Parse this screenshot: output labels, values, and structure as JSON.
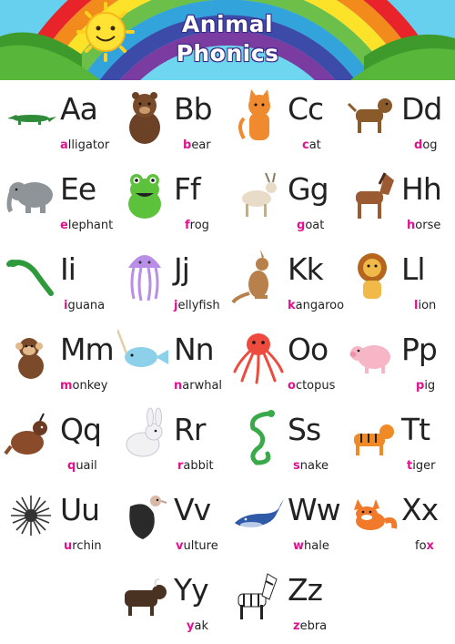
{
  "title": {
    "line1": "Animal",
    "line2": "Phonics"
  },
  "colors": {
    "highlight": "#e2128f",
    "text": "#222222",
    "title_text": "#ffffff"
  },
  "animals": [
    {
      "letters": "Aa",
      "first": "a",
      "rest": "lligator",
      "last": "",
      "icon": "alligator-icon"
    },
    {
      "letters": "Bb",
      "first": "b",
      "rest": "ear",
      "last": "",
      "icon": "bear-icon"
    },
    {
      "letters": "Cc",
      "first": "c",
      "rest": "at",
      "last": "",
      "icon": "cat-icon"
    },
    {
      "letters": "Dd",
      "first": "d",
      "rest": "og",
      "last": "",
      "icon": "dog-icon"
    },
    {
      "letters": "Ee",
      "first": "e",
      "rest": "lephant",
      "last": "",
      "icon": "elephant-icon"
    },
    {
      "letters": "Ff",
      "first": "f",
      "rest": "rog",
      "last": "",
      "icon": "frog-icon"
    },
    {
      "letters": "Gg",
      "first": "g",
      "rest": "oat",
      "last": "",
      "icon": "goat-icon"
    },
    {
      "letters": "Hh",
      "first": "h",
      "rest": "orse",
      "last": "",
      "icon": "horse-icon"
    },
    {
      "letters": "Ii",
      "first": "i",
      "rest": "guana",
      "last": "",
      "icon": "iguana-icon"
    },
    {
      "letters": "Jj",
      "first": "j",
      "rest": "ellyfish",
      "last": "",
      "icon": "jellyfish-icon"
    },
    {
      "letters": "Kk",
      "first": "k",
      "rest": "angaroo",
      "last": "",
      "icon": "kangaroo-icon"
    },
    {
      "letters": "Ll",
      "first": "l",
      "rest": "ion",
      "last": "",
      "icon": "lion-icon"
    },
    {
      "letters": "Mm",
      "first": "m",
      "rest": "onkey",
      "last": "",
      "icon": "monkey-icon"
    },
    {
      "letters": "Nn",
      "first": "n",
      "rest": "arwhal",
      "last": "",
      "icon": "narwhal-icon"
    },
    {
      "letters": "Oo",
      "first": "o",
      "rest": "ctopus",
      "last": "",
      "icon": "octopus-icon"
    },
    {
      "letters": "Pp",
      "first": "p",
      "rest": "ig",
      "last": "",
      "icon": "pig-icon"
    },
    {
      "letters": "Qq",
      "first": "q",
      "rest": "uail",
      "last": "",
      "icon": "quail-icon"
    },
    {
      "letters": "Rr",
      "first": "r",
      "rest": "abbit",
      "last": "",
      "icon": "rabbit-icon"
    },
    {
      "letters": "Ss",
      "first": "s",
      "rest": "nake",
      "last": "",
      "icon": "snake-icon"
    },
    {
      "letters": "Tt",
      "first": "t",
      "rest": "iger",
      "last": "",
      "icon": "tiger-icon"
    },
    {
      "letters": "Uu",
      "first": "u",
      "rest": "rchin",
      "last": "",
      "icon": "urchin-icon"
    },
    {
      "letters": "Vv",
      "first": "v",
      "rest": "ulture",
      "last": "",
      "icon": "vulture-icon"
    },
    {
      "letters": "Ww",
      "first": "w",
      "rest": "hale",
      "last": "",
      "icon": "whale-icon"
    },
    {
      "letters": "Xx",
      "first": "",
      "rest": "fo",
      "last": "x",
      "icon": "fox-icon"
    },
    {
      "letters": "Yy",
      "first": "y",
      "rest": "ak",
      "last": "",
      "icon": "yak-icon"
    },
    {
      "letters": "Zz",
      "first": "z",
      "rest": "ebra",
      "last": "",
      "icon": "zebra-icon"
    }
  ]
}
